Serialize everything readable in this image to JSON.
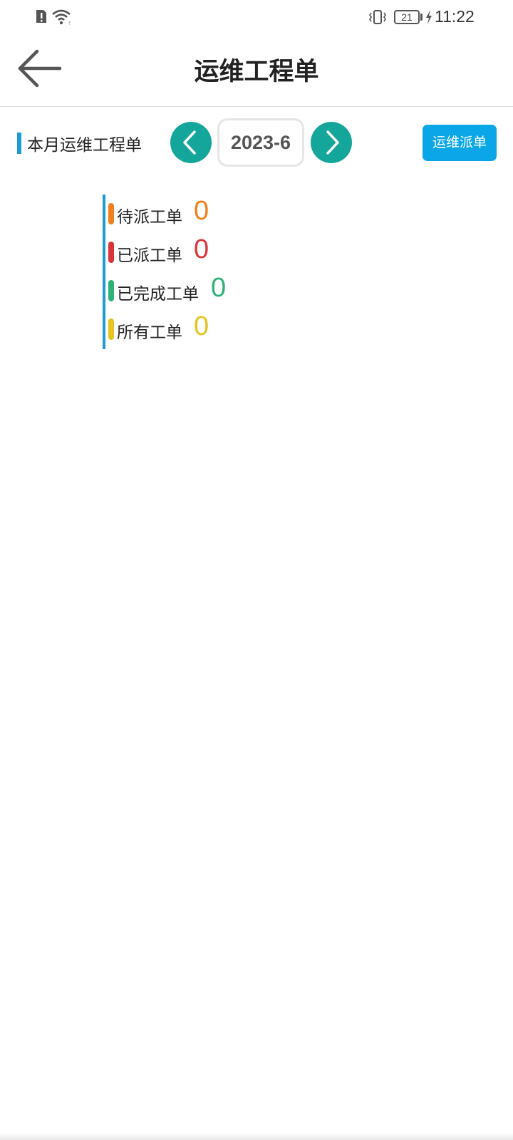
{
  "status_bar": {
    "battery_level": "21",
    "time": "11:22"
  },
  "header": {
    "title": "运维工程单"
  },
  "month_bar": {
    "label": "本月运维工程单",
    "current_month": "2023-6",
    "dispatch_label": "运维派单"
  },
  "stats": [
    {
      "label": "待派工单",
      "count": "0",
      "color": "#f07f1f"
    },
    {
      "label": "已派工单",
      "count": "0",
      "color": "#d9353a"
    },
    {
      "label": "已完成工单",
      "count": "0",
      "color": "#2eb27a"
    },
    {
      "label": "所有工单",
      "count": "0",
      "color": "#e6c320"
    }
  ],
  "colors": {
    "accent_blue": "#1e9ad6",
    "nav_teal": "#14a69a",
    "button_blue": "#0aa6e8"
  },
  "icons": {
    "back": "back-arrow-icon",
    "prev": "chevron-left-icon",
    "next": "chevron-right-icon"
  }
}
